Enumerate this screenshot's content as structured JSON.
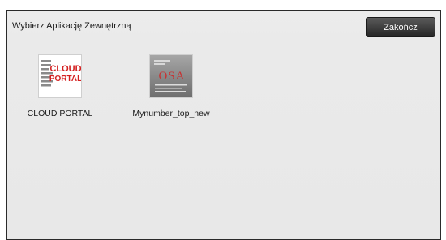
{
  "header": {
    "title": "Wybierz Aplikację Zewnętrzną",
    "exit_label": "Zakończ"
  },
  "apps": [
    {
      "label": "CLOUD PORTAL",
      "icon": "cloud-portal-icon",
      "icon_text_line1": "CLOUD",
      "icon_text_line2": "PORTAL",
      "accent": "#d42020"
    },
    {
      "label": "Mynumber_top_new",
      "icon": "mynumber-icon",
      "icon_text": "OSA",
      "accent": "#c83232"
    }
  ]
}
